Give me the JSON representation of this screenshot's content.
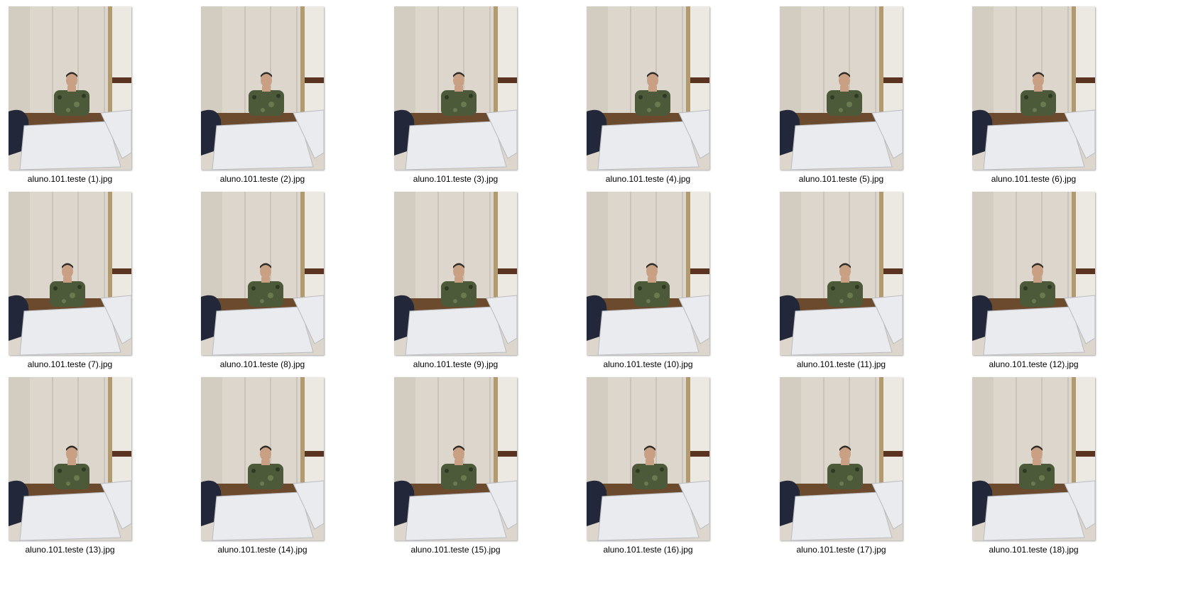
{
  "files": [
    {
      "name": "aluno.101.teste (1).jpg"
    },
    {
      "name": "aluno.101.teste (2).jpg"
    },
    {
      "name": "aluno.101.teste (3).jpg"
    },
    {
      "name": "aluno.101.teste (4).jpg"
    },
    {
      "name": "aluno.101.teste (5).jpg"
    },
    {
      "name": "aluno.101.teste (6).jpg"
    },
    {
      "name": "aluno.101.teste (7).jpg"
    },
    {
      "name": "aluno.101.teste (8).jpg"
    },
    {
      "name": "aluno.101.teste (9).jpg"
    },
    {
      "name": "aluno.101.teste (10).jpg"
    },
    {
      "name": "aluno.101.teste (11).jpg"
    },
    {
      "name": "aluno.101.teste (12).jpg"
    },
    {
      "name": "aluno.101.teste (13).jpg"
    },
    {
      "name": "aluno.101.teste (14).jpg"
    },
    {
      "name": "aluno.101.teste (15).jpg"
    },
    {
      "name": "aluno.101.teste (16).jpg"
    },
    {
      "name": "aluno.101.teste (17).jpg"
    },
    {
      "name": "aluno.101.teste (18).jpg"
    }
  ],
  "colors": {
    "wall": "#ddd6cc",
    "wall_shadow": "#c9c1b6",
    "floor": "#6b4a2e",
    "table": "#e9ebee",
    "table_edge": "#b9bcc0",
    "shirt": "#4c5a3a",
    "skin": "#c9a084",
    "hair": "#2e2a26",
    "bag": "#22283a"
  }
}
